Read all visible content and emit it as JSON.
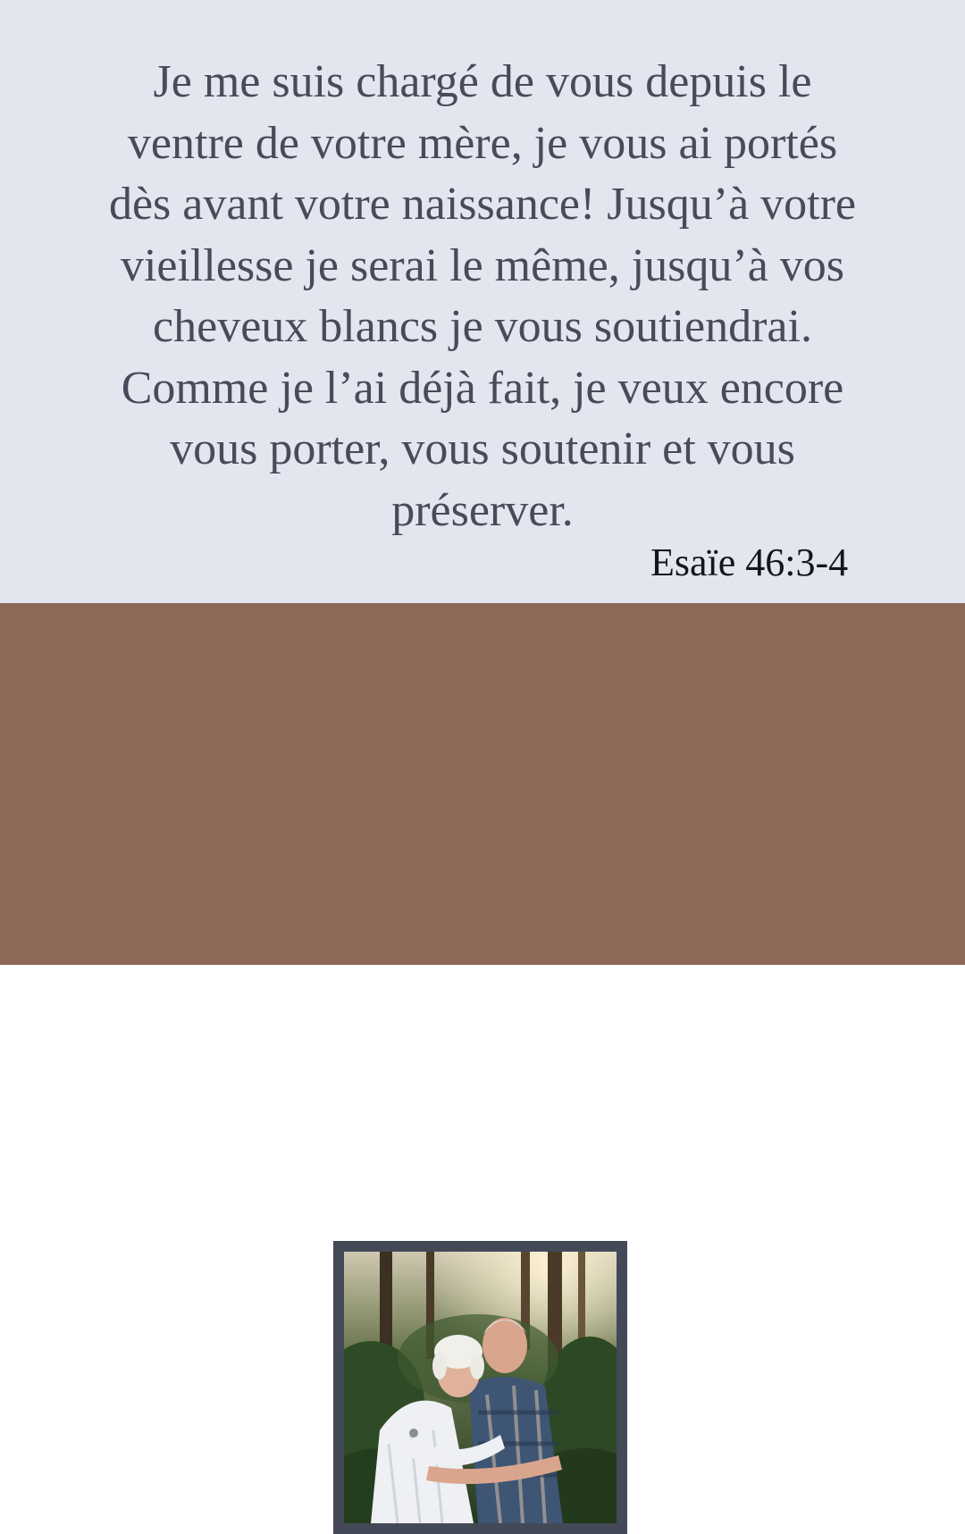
{
  "verse": {
    "lines": [
      "Je me suis chargé de vous depuis le",
      "ventre de votre mère, je vous ai portés",
      "dès avant votre naissance! Jusqu’à votre",
      "vieillesse je serai le même, jusqu’à vos",
      "cheveux blancs je vous soutiendrai.",
      "Comme je l’ai déjà fait, je veux encore",
      "vous porter, vous soutenir et vous",
      "préserver."
    ],
    "reference": "Esaïe 46:3-4"
  },
  "photo": {
    "description_icon": "elderly-couple-hugging-photo"
  },
  "colors": {
    "top_background": "#e2e6ef",
    "bottom_background": "#8e6958",
    "verse_text": "#474b5a",
    "reference_text": "#15161c",
    "frame": "#434957"
  }
}
